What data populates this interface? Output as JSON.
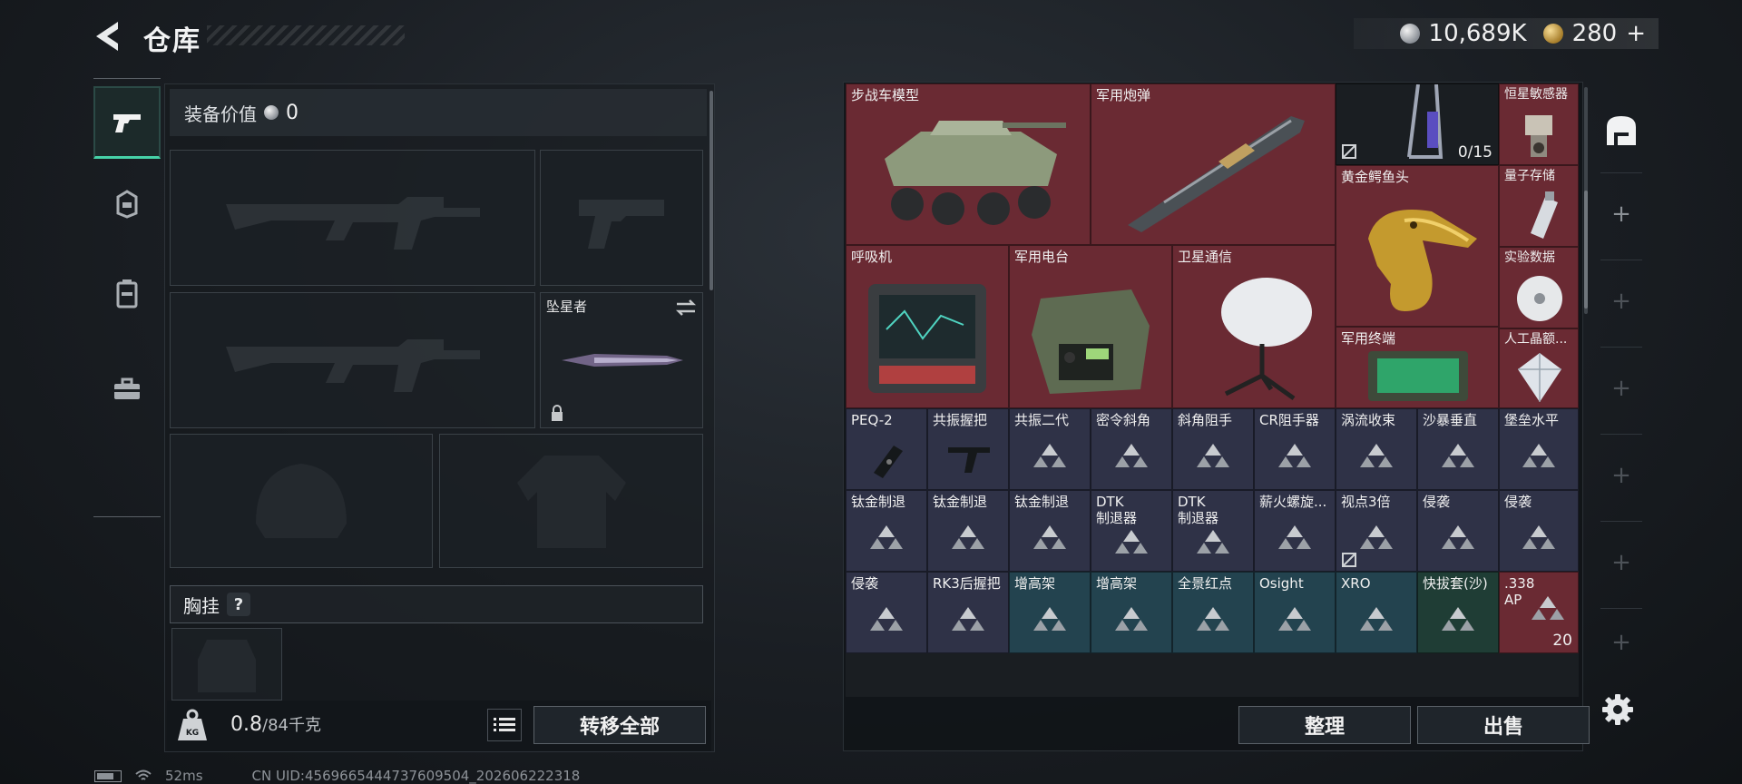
{
  "header": {
    "title": "仓库"
  },
  "currency": {
    "silver": "10,689K",
    "gold": "280",
    "gold_plus": "+"
  },
  "loadout": {
    "equip_value_label": "装备价值",
    "equip_value": "0",
    "melee_name": "坠星者",
    "chest_label": "胸挂",
    "chest_help": "?",
    "weight_current": "0.8",
    "weight_max": "/84千克",
    "transfer_all": "转移全部"
  },
  "stash": {
    "items": [
      {
        "name": "步战车模型",
        "color": "red"
      },
      {
        "name": "军用炮弹",
        "color": "red"
      },
      {
        "name": "",
        "color": "dark",
        "count": "0/15"
      },
      {
        "name": "恒星敏感器",
        "color": "red"
      },
      {
        "name": "黄金鳄鱼头",
        "color": "red"
      },
      {
        "name": "量子存储",
        "color": "red"
      },
      {
        "name": "呼吸机",
        "color": "red"
      },
      {
        "name": "军用电台",
        "color": "red"
      },
      {
        "name": "卫星通信",
        "color": "red"
      },
      {
        "name": "实验数据",
        "color": "red"
      },
      {
        "name": "军用终端",
        "color": "red"
      },
      {
        "name": "人工晶额...",
        "color": "red"
      },
      {
        "name": "PEQ-2",
        "color": "blue"
      },
      {
        "name": "共振握把",
        "color": "blue"
      },
      {
        "name": "共振二代",
        "color": "blue"
      },
      {
        "name": "密令斜角",
        "color": "blue"
      },
      {
        "name": "斜角阻手",
        "color": "blue"
      },
      {
        "name": "CR阻手器",
        "color": "blue"
      },
      {
        "name": "涡流收束",
        "color": "blue"
      },
      {
        "name": "沙暴垂直",
        "color": "blue"
      },
      {
        "name": "堡垒水平",
        "color": "blue"
      },
      {
        "name": "钛金制退",
        "color": "blue"
      },
      {
        "name": "钛金制退",
        "color": "blue"
      },
      {
        "name": "钛金制退",
        "color": "blue"
      },
      {
        "name": "DTK\n制退器",
        "color": "blue"
      },
      {
        "name": "DTK\n制退器",
        "color": "blue"
      },
      {
        "name": "薪火螺旋...",
        "color": "blue"
      },
      {
        "name": "视点3倍",
        "color": "blue"
      },
      {
        "name": "侵袭",
        "color": "blue"
      },
      {
        "name": "侵袭",
        "color": "blue"
      },
      {
        "name": "侵袭",
        "color": "blue"
      },
      {
        "name": "RK3后握把",
        "color": "blue"
      },
      {
        "name": "增高架",
        "color": "teal"
      },
      {
        "name": "增高架",
        "color": "teal"
      },
      {
        "name": "全景红点",
        "color": "teal"
      },
      {
        "name": "Osight",
        "color": "teal"
      },
      {
        "name": "XRO",
        "color": "teal"
      },
      {
        "name": "快拔套(沙)",
        "color": "green"
      },
      {
        "name": ".338\nAP",
        "color": "red",
        "count": "20"
      }
    ]
  },
  "actions": {
    "sort": "整理",
    "sell": "出售"
  },
  "status": {
    "ping": "52ms",
    "uid": "CN UID:4569665444737609504_202606222318"
  },
  "colors": {
    "accent": "#46d2a8",
    "rarity_red": "#6a2a33",
    "rarity_blue": "#2f3247",
    "rarity_teal": "#23434f",
    "rarity_green": "#1f3d35"
  }
}
